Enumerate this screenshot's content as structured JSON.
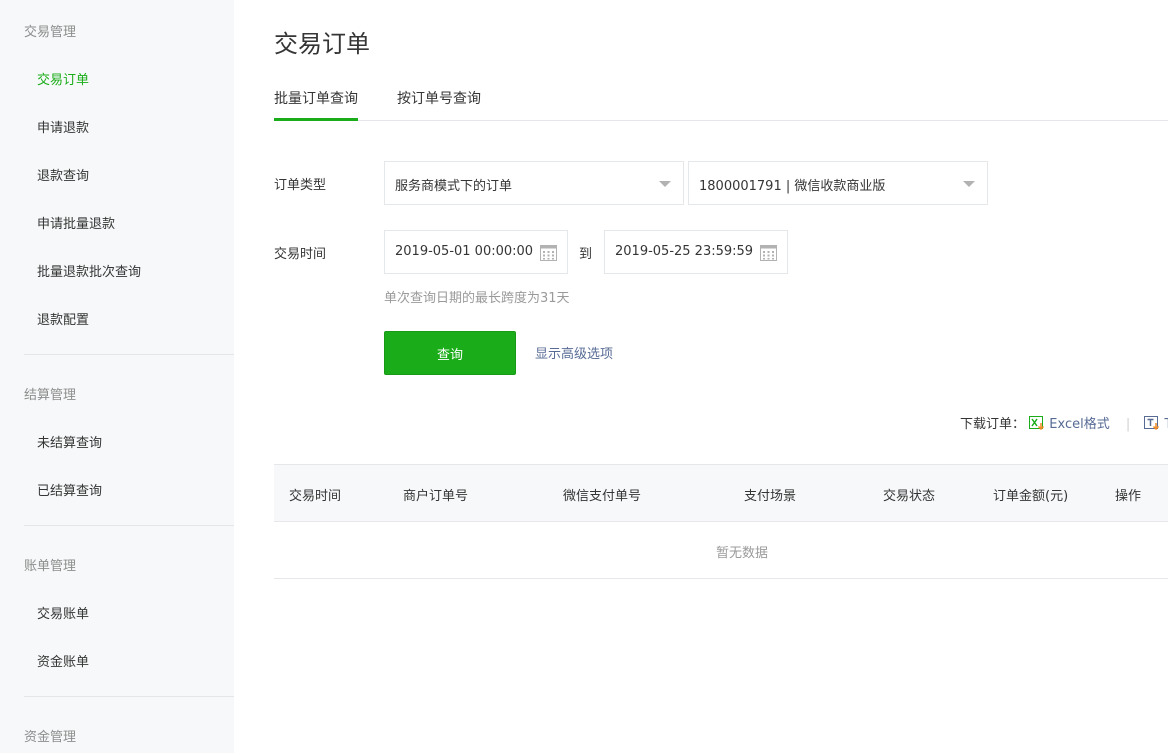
{
  "sidebar": {
    "groups": [
      {
        "title": "交易管理",
        "items": [
          "交易订单",
          "申请退款",
          "退款查询",
          "申请批量退款",
          "批量退款批次查询",
          "退款配置"
        ]
      },
      {
        "title": "结算管理",
        "items": [
          "未结算查询",
          "已结算查询"
        ]
      },
      {
        "title": "账单管理",
        "items": [
          "交易账单",
          "资金账单"
        ]
      },
      {
        "title": "资金管理",
        "items": []
      }
    ],
    "active_item": "交易订单"
  },
  "page": {
    "title": "交易订单"
  },
  "tabs": [
    {
      "label": "批量订单查询",
      "active": true
    },
    {
      "label": "按订单号查询",
      "active": false
    }
  ],
  "form": {
    "order_type_label": "订单类型",
    "order_type_select_1": "服务商模式下的订单",
    "order_type_select_2": "1800001791 | 微信收款商业版",
    "time_label": "交易时间",
    "start_time": "2019-05-01 00:00:00",
    "to_text": "到",
    "end_time": "2019-05-25 23:59:59",
    "hint": "单次查询日期的最长跨度为31天",
    "query_button": "查询",
    "advanced_link": "显示高级选项"
  },
  "download": {
    "label": "下载订单：",
    "excel_link": "Excel格式",
    "separator": "|",
    "txt_link": "T"
  },
  "table": {
    "headers": [
      "交易时间",
      "商户订单号",
      "微信支付单号",
      "支付场景",
      "交易状态",
      "订单金额(元)",
      "操作"
    ],
    "empty_text": "暂无数据"
  },
  "colors": {
    "accent": "#1aad19",
    "link": "#576b95",
    "sidebar_bg": "#f6f8f9"
  }
}
